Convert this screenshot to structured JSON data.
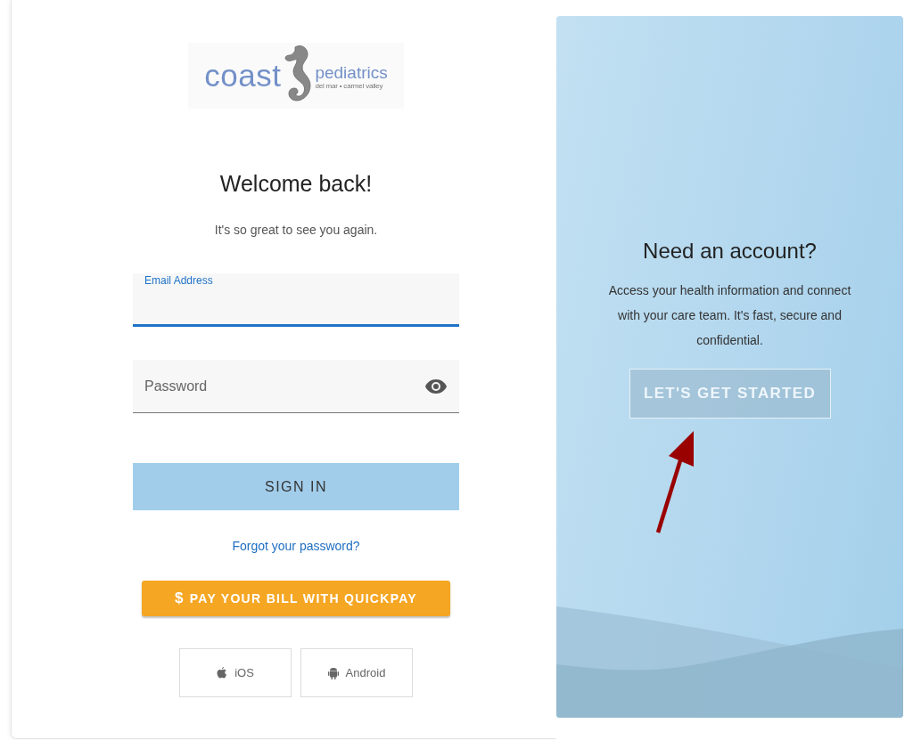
{
  "logo": {
    "name": "coast",
    "subname": "pediatrics",
    "tagline": "del mar • carmel valley"
  },
  "login": {
    "title": "Welcome back!",
    "subtitle": "It's so great to see you again.",
    "fields": [
      {
        "kind": "text",
        "label": "Email Address",
        "focused": true
      },
      {
        "kind": "password",
        "placeholder": "Password",
        "focused": false
      }
    ],
    "sign_in": "SIGN IN",
    "forgot": "Forgot your password?",
    "quickpay": {
      "symbol": "$",
      "label": "PAY YOUR BILL WITH QUICKPAY"
    },
    "apps": [
      {
        "kind": "ios",
        "label": "iOS"
      },
      {
        "kind": "android",
        "label": "Android"
      }
    ]
  },
  "signup": {
    "title": "Need an account?",
    "text": "Access your health information and connect with your care team. It's fast, secure and confidential.",
    "button": "LET'S GET STARTED"
  }
}
